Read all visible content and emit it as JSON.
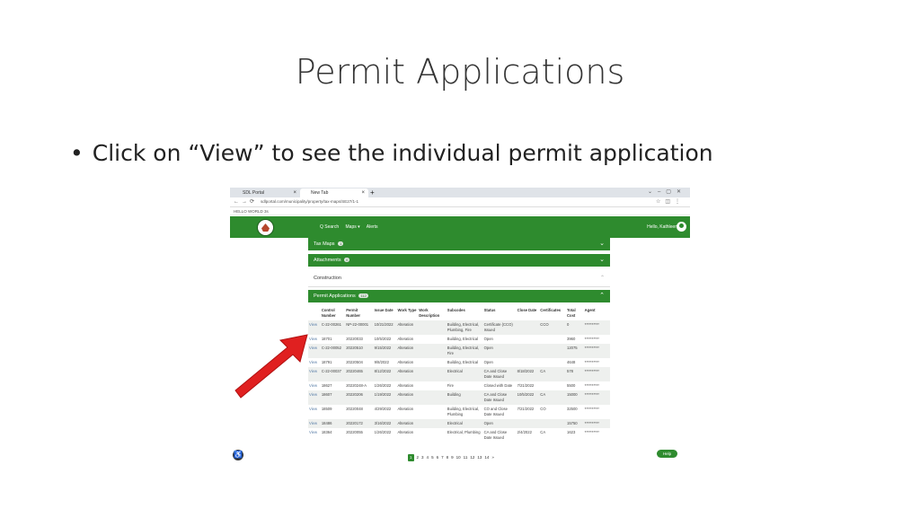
{
  "slide": {
    "title": "Permit Applications",
    "bullet": "Click on “View” to see the individual permit application"
  },
  "browser": {
    "tabs": [
      "SDL Portal",
      "New Tab"
    ],
    "url": "sdlportal.com/municipality/property/tax-maps/SE27/1-1",
    "bookmark": "HELLO WORLD  3s"
  },
  "header": {
    "search": "Q Search",
    "maps": "Maps ▾",
    "alerts": "Alerts",
    "greeting": "Hello, Kathleen"
  },
  "sections": {
    "tax_maps": {
      "label": "Tax Maps",
      "count": "1"
    },
    "attachments": {
      "label": "Attachments",
      "count": "0"
    },
    "construction": {
      "label": "Construction"
    },
    "permit_apps": {
      "label": "Permit Applications",
      "count": "112"
    }
  },
  "table": {
    "headers": [
      "",
      "Control Number",
      "Permit Number",
      "Issue Date",
      "Work Type",
      "Work Description",
      "Subcodes",
      "Status",
      "Close Date",
      "Certificates",
      "Total Cost",
      "Agent"
    ],
    "rows": [
      [
        "View",
        "C-22-00261",
        "NP-22-00001",
        "10/21/2022",
        "Alteration",
        "",
        "Building, Electrical, Plumbing, Fire",
        "Certificate (CCO) Issued",
        "",
        "CCO",
        "0",
        "**********"
      ],
      [
        "View",
        "18701",
        "20220033",
        "10/5/2022",
        "Alteration",
        "",
        "Building, Electrical",
        "Open",
        "",
        "",
        "3960",
        "**********"
      ],
      [
        "View",
        "C-22-00052",
        "20220510",
        "9/15/2022",
        "Alteration",
        "",
        "Building, Electrical, Fire",
        "Open",
        "",
        "",
        "12075",
        "**********"
      ],
      [
        "View",
        "18791",
        "20220504",
        "9/8/2022",
        "Alteration",
        "",
        "Building, Electrical",
        "Open",
        "",
        "",
        "4648",
        "**********"
      ],
      [
        "View",
        "C-22-00037",
        "20220465",
        "8/12/2022",
        "Alteration",
        "",
        "Electrical",
        "CA and Close Date Issued",
        "8/18/2022",
        "CA",
        "578",
        "**********"
      ],
      [
        "View",
        "18627",
        "20220248-A",
        "1/26/2022",
        "Alteration",
        "",
        "Fire",
        "Closed with Date",
        "7/21/2022",
        "",
        "5500",
        "**********"
      ],
      [
        "View",
        "18607",
        "20220206",
        "1/19/2022",
        "Alteration",
        "",
        "Building",
        "CA and Close Date Issued",
        "10/5/2022",
        "CA",
        "15000",
        "**********"
      ],
      [
        "View",
        "18509",
        "20220048",
        "4/29/2022",
        "Alteration",
        "",
        "Building, Electrical, Plumbing",
        "CO and Close Date Issued",
        "7/21/2022",
        "CO",
        "32500",
        "**********"
      ],
      [
        "View",
        "18486",
        "20220172",
        "3/16/2022",
        "Alteration",
        "",
        "Electrical",
        "Open",
        "",
        "",
        "15750",
        "**********"
      ],
      [
        "View",
        "18364",
        "20220055",
        "1/26/2022",
        "Alteration",
        "",
        "Electrical, Plumbing",
        "CA and Close Date Issued",
        "2/4/2022",
        "CA",
        "1623",
        "**********"
      ]
    ]
  },
  "pagination": [
    "1",
    "2",
    "3",
    "4",
    "5",
    "6",
    "7",
    "8",
    "9",
    "10",
    "11",
    "12",
    "13",
    "14",
    "»"
  ],
  "help": "Help",
  "colors": {
    "brand_green": "#2e8b2e",
    "arrow_red": "#e02020"
  }
}
